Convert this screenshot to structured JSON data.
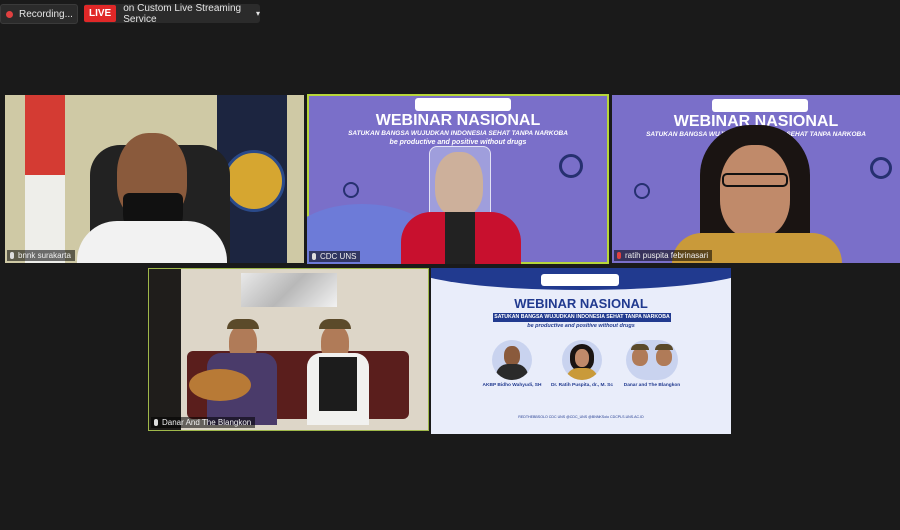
{
  "toolbar": {
    "recording_label": "Recording...",
    "live_badge": "LIVE",
    "stream_label": "on Custom Live Streaming Service",
    "stream_caret": "▾"
  },
  "tiles": [
    {
      "name": "bnnk surakarta"
    },
    {
      "name": "CDC UNS"
    },
    {
      "name": "ratih puspita febrinasari"
    },
    {
      "name": "Danar And The Blangkon"
    }
  ],
  "webinar": {
    "title": "WEBINAR NASIONAL",
    "subtitle": "SATUKAN BANGSA WUJUDKAN INDONESIA SEHAT TANPA NARKOBA",
    "tagline": "be productive and positive without drugs",
    "badge_text": "CDC UNS"
  },
  "poster": {
    "title": "WEBINAR NASIONAL",
    "subtitle": "SATUKAN  BANGSA WUJUDKAN INDONESIA SEHAT TANPA NARKOBA",
    "tagline": "be productive and positive without drugs",
    "speakers": [
      {
        "name": "AKBP Bidho Wahyudi, SH"
      },
      {
        "name": "Dr. Ratih Puspita, dr., M. Sc"
      },
      {
        "name": "Danar and The Blangkon"
      }
    ],
    "footer": "REDTHEBBSOLO  CDC UNS  @CDC_UNS  @BNNKSolo  CDCPLS.UNS.AC.ID"
  },
  "colors": {
    "background": "#1a1a1a",
    "active_outline": "#b7d63a",
    "live_red": "#e02828",
    "webinar_purple": "#7a6fc9",
    "poster_navy": "#213a8f"
  }
}
